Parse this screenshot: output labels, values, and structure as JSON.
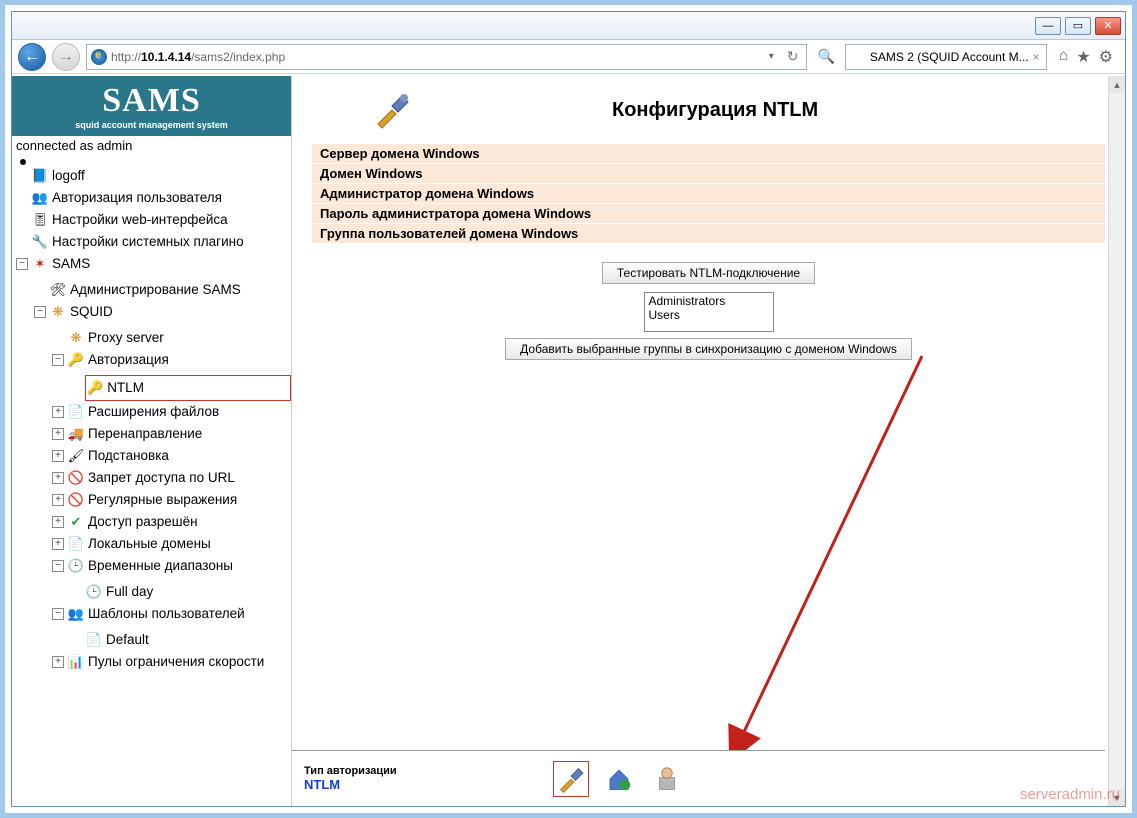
{
  "browser": {
    "url_prefix": "http://",
    "url_host": "10.1.4.14",
    "url_path": "/sams2/index.php",
    "tab_title": "SAMS 2 (SQUID Account M..."
  },
  "brand": {
    "name": "SAMS",
    "subtitle": "squid account management system"
  },
  "status": "connected as admin",
  "tree": {
    "logoff": "logoff",
    "user_auth": "Авторизация пользователя",
    "web_settings": "Настройки web-интерфейса",
    "sys_plugins": "Настройки системных плагино",
    "sams": "SAMS",
    "admin_sams": "Администрирование SAMS",
    "squid": "SQUID",
    "proxy": "Proxy server",
    "authz": "Авторизация",
    "ntlm": "NTLM",
    "file_ext": "Расширения файлов",
    "redirect": "Перенаправление",
    "subst": "Подстановка",
    "deny_url": "Запрет доступа по URL",
    "regex": "Регулярные выражения",
    "allow": "Доступ разрешён",
    "local_dom": "Локальные домены",
    "time_ranges": "Временные диапазоны",
    "full_day": "Full day",
    "user_tpl": "Шаблоны пользователей",
    "default": "Default",
    "speed_pools": "Пулы ограничения скорости"
  },
  "main": {
    "title": "Конфигурация NTLM",
    "fields": {
      "srv": "Сервер домена Windows",
      "domain": "Домен Windows",
      "admin": "Администратор домена Windows",
      "passwd": "Пароль администратора домена Windows",
      "group": "Группа пользователей домена Windows"
    },
    "btn_test": "Тестировать NTLM-подключение",
    "listbox": {
      "item1": "Administrators",
      "item2": "Users"
    },
    "btn_add": "Добавить выбранные группы в синхронизацию с доменом Windows"
  },
  "bottom": {
    "label": "Тип авторизации",
    "value": "NTLM"
  },
  "watermark": "serveradmin.ru"
}
